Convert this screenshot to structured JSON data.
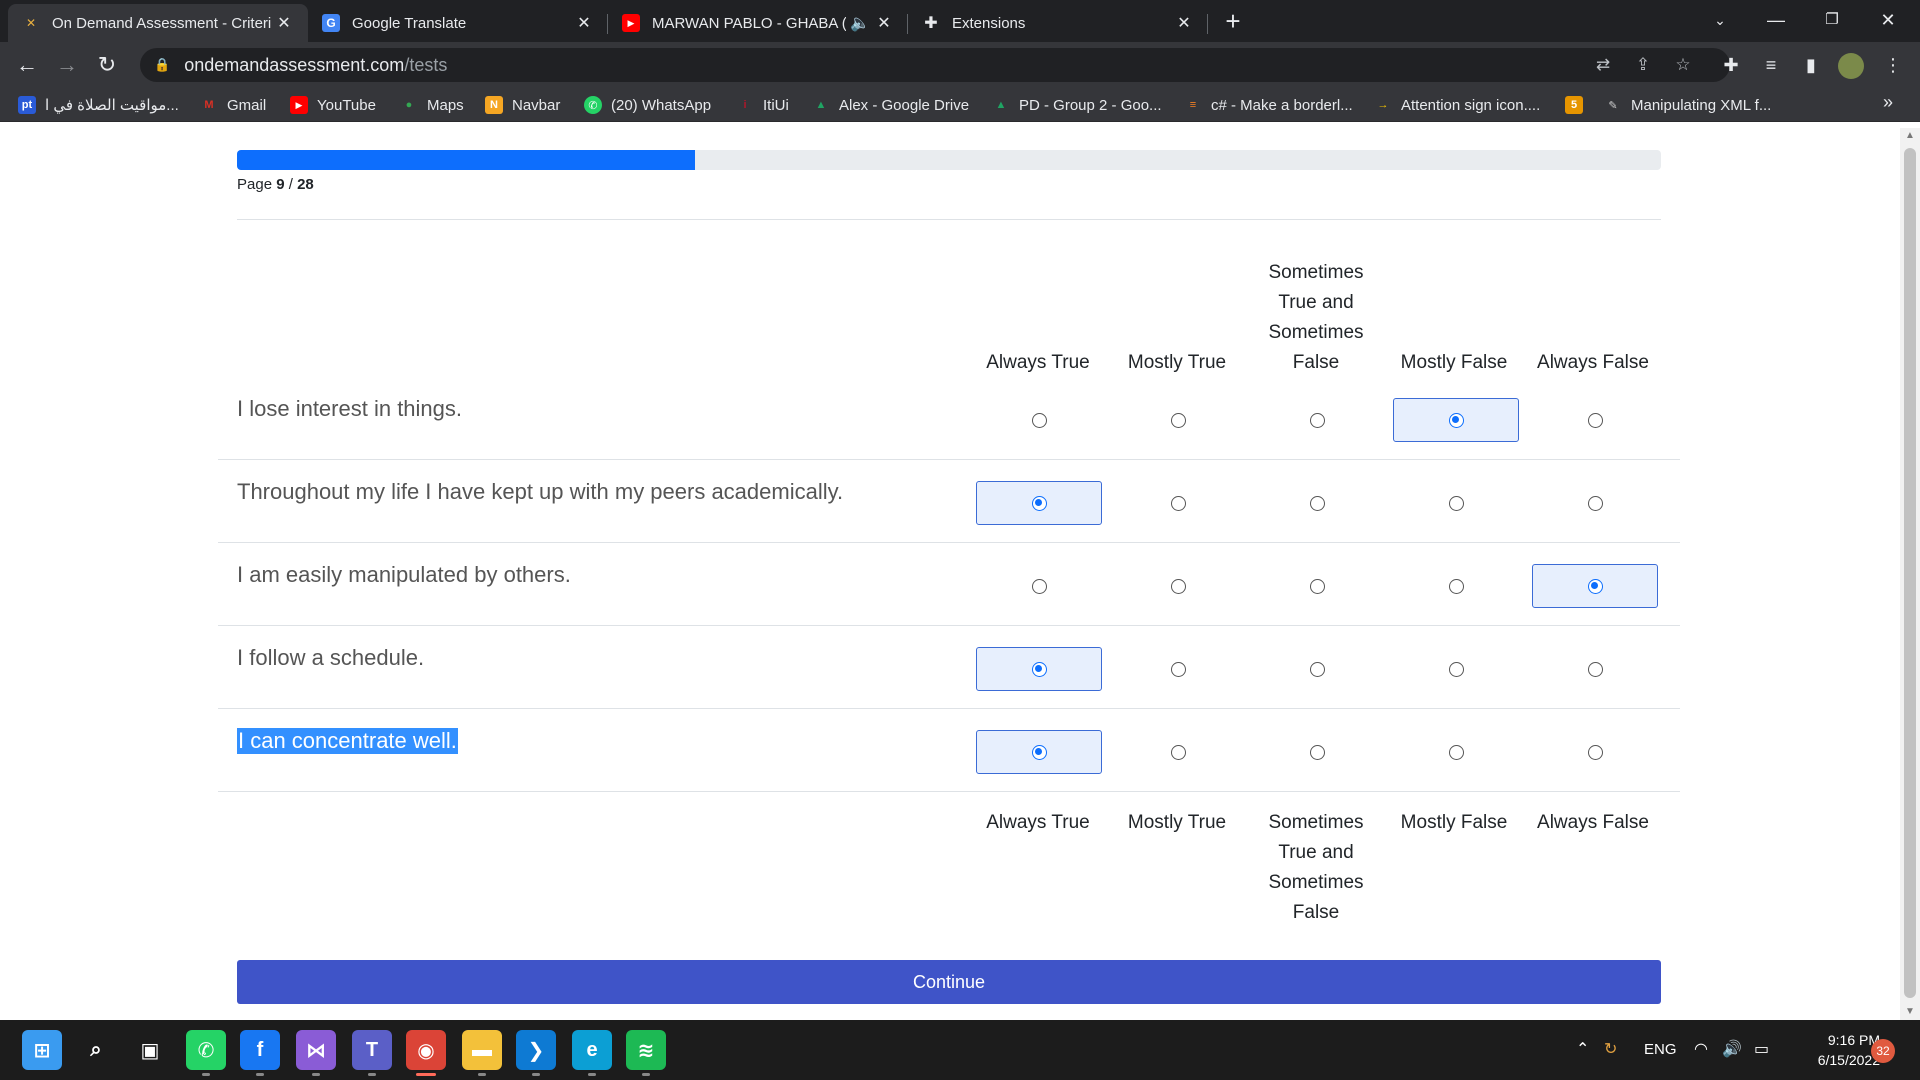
{
  "browser": {
    "tabs": [
      {
        "title": "On Demand Assessment - Criteri",
        "favicon": "criteria-logo-icon",
        "active": true
      },
      {
        "title": "Google Translate",
        "favicon": "google-translate-icon",
        "active": false
      },
      {
        "title": "MARWAN PABLO - GHABA (",
        "favicon": "youtube-icon",
        "active": false,
        "audio": "speaker-icon"
      },
      {
        "title": "Extensions",
        "favicon": "puzzle-icon",
        "active": false
      }
    ],
    "address": {
      "host": "ondemandassessment.com",
      "path": "/tests"
    },
    "bookmarks": [
      {
        "label": "مواقيت الصلاة في ا...",
        "icon": "pt-icon",
        "color": "#2a5bd7",
        "glyph": "pt"
      },
      {
        "label": "Gmail",
        "icon": "gmail-icon",
        "color": "#d93025",
        "glyph": "M"
      },
      {
        "label": "YouTube",
        "icon": "youtube-icon",
        "color": "#ff0000",
        "glyph": "▶"
      },
      {
        "label": "Maps",
        "icon": "maps-icon",
        "color": "#34a853",
        "glyph": "●"
      },
      {
        "label": "Navbar",
        "icon": "navbar-icon",
        "color": "#f5a623",
        "glyph": "N"
      },
      {
        "label": "(20) WhatsApp",
        "icon": "whatsapp-icon",
        "color": "#25d366",
        "glyph": "✆"
      },
      {
        "label": "ItiUi",
        "icon": "iti-icon",
        "color": "#b0172a",
        "glyph": "i"
      },
      {
        "label": "Alex - Google Drive",
        "icon": "google-drive-icon",
        "color": "#1fa463",
        "glyph": "▲"
      },
      {
        "label": "PD - Group 2 - Goo...",
        "icon": "google-drive-icon",
        "color": "#1fa463",
        "glyph": "▲"
      },
      {
        "label": "c# - Make a borderl...",
        "icon": "stackoverflow-icon",
        "color": "#f48024",
        "glyph": "≡"
      },
      {
        "label": "Attention sign icon....",
        "icon": "arrow-icon",
        "color": "#f5c400",
        "glyph": "→"
      },
      {
        "label": "",
        "icon": "number-five-icon",
        "color": "#e69500",
        "glyph": "5"
      },
      {
        "label": "Manipulating XML f...",
        "icon": "xml-icon",
        "color": "#6a6a6a",
        "glyph": "✎"
      }
    ]
  },
  "test": {
    "progress": {
      "current": 9,
      "total": 28,
      "fraction": 0.3214
    },
    "page_label": "Page",
    "separator": "/",
    "columns": [
      "Always True",
      "Mostly True",
      "Sometimes True and Sometimes False",
      "Mostly False",
      "Always False"
    ],
    "columns_lines": [
      [
        "Always True"
      ],
      [
        "Mostly True"
      ],
      [
        "Sometimes",
        "True and",
        "Sometimes",
        "False"
      ],
      [
        "Mostly False"
      ],
      [
        "Always False"
      ]
    ],
    "questions": [
      {
        "text": "I lose interest in things.",
        "selected": 3,
        "highlighted": false
      },
      {
        "text": "Throughout my life I have kept up with my peers academically.",
        "selected": 0,
        "highlighted": false
      },
      {
        "text": "I am easily manipulated by others.",
        "selected": 4,
        "highlighted": false
      },
      {
        "text": "I follow a schedule.",
        "selected": 0,
        "highlighted": false
      },
      {
        "text": "I can concentrate well.",
        "selected": 0,
        "highlighted": true
      }
    ],
    "continue_label": "Continue"
  },
  "taskbar": {
    "apps": [
      {
        "name": "windows-start-icon",
        "color": "#3a9bf0",
        "glyph": "⊞"
      },
      {
        "name": "search-icon",
        "color": "transparent",
        "glyph": "⌕"
      },
      {
        "name": "task-view-icon",
        "color": "transparent",
        "glyph": "▣"
      },
      {
        "name": "whatsapp-icon",
        "color": "#25d366",
        "glyph": "✆"
      },
      {
        "name": "facebook-icon",
        "color": "#1877f2",
        "glyph": "f"
      },
      {
        "name": "visual-studio-icon",
        "color": "#8a5cd6",
        "glyph": "⋈"
      },
      {
        "name": "teams-icon",
        "color": "#5b5fc7",
        "glyph": "T"
      },
      {
        "name": "chrome-icon",
        "color": "#db4437",
        "glyph": "◉",
        "active": true
      },
      {
        "name": "file-explorer-icon",
        "color": "#f3c13a",
        "glyph": "▬"
      },
      {
        "name": "vscode-icon",
        "color": "#0e7ad3",
        "glyph": "❯"
      },
      {
        "name": "edge-icon",
        "color": "#0c9fd4",
        "glyph": "e"
      },
      {
        "name": "spotify-icon",
        "color": "#1db954",
        "glyph": "≋"
      }
    ],
    "tray": {
      "language": "ENG",
      "time": "9:16 PM",
      "date": "6/15/2022",
      "notifications": "32"
    }
  }
}
